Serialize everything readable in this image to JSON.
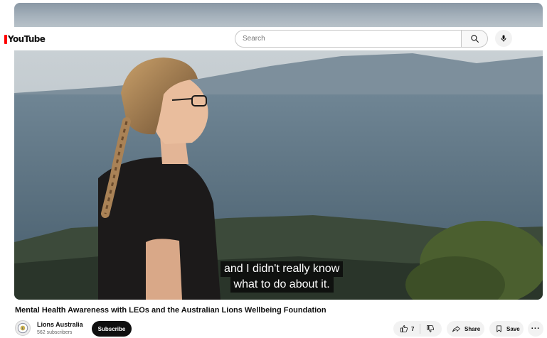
{
  "header": {
    "logo_text": "YouTube",
    "search_placeholder": "Search"
  },
  "video": {
    "caption_line1": "and I didn't really know",
    "caption_line2": "what to do about it."
  },
  "title": "Mental Health Awareness with LEOs and the Australian Lions Wellbeing Foundation",
  "channel": {
    "name": "Lions Australia",
    "subscribers": "562 subscribers",
    "subscribe_label": "Subscribe"
  },
  "actions": {
    "like_count": "7",
    "share_label": "Share",
    "save_label": "Save",
    "more_label": "···"
  },
  "colors": {
    "brand_red": "#ff0000",
    "subscribe_bg": "#0f0f0f",
    "pill_bg": "#f2f2f2"
  },
  "icons": [
    "youtube-logo-icon",
    "search-icon",
    "mic-icon",
    "like-icon",
    "dislike-icon",
    "share-icon",
    "save-icon",
    "more-icon",
    "channel-avatar-icon"
  ]
}
